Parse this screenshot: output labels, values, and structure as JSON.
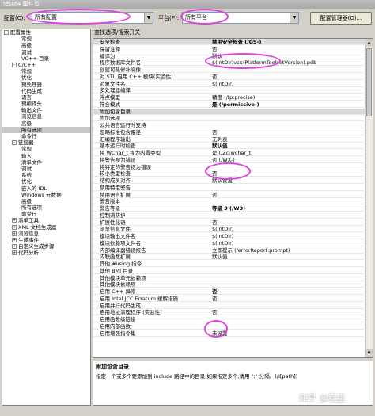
{
  "window": {
    "title": "test64 属性页"
  },
  "toolbar": {
    "config_label": "配置(C):",
    "config_value": "所有配置",
    "platform_label": "平台(P):",
    "platform_value": "所有平台",
    "config_manager_label": "配置管理器(O)..."
  },
  "panel_header": "查找选项/搜索开关",
  "tree": [
    {
      "label": "配置属性",
      "indent": 0,
      "exp": "-"
    },
    {
      "label": "常规",
      "indent": 2
    },
    {
      "label": "高级",
      "indent": 2
    },
    {
      "label": "调试",
      "indent": 2
    },
    {
      "label": "VC++ 目录",
      "indent": 2
    },
    {
      "label": "C/C++",
      "indent": 1,
      "exp": "-"
    },
    {
      "label": "常规",
      "indent": 2
    },
    {
      "label": "优化",
      "indent": 2
    },
    {
      "label": "预处理器",
      "indent": 2
    },
    {
      "label": "代码生成",
      "indent": 2
    },
    {
      "label": "语言",
      "indent": 2
    },
    {
      "label": "预编译头",
      "indent": 2
    },
    {
      "label": "输出文件",
      "indent": 2
    },
    {
      "label": "浏览信息",
      "indent": 2
    },
    {
      "label": "高级",
      "indent": 2
    },
    {
      "label": "所有选项",
      "indent": 2,
      "selected": true
    },
    {
      "label": "命令行",
      "indent": 2
    },
    {
      "label": "链接器",
      "indent": 1,
      "exp": "-"
    },
    {
      "label": "常规",
      "indent": 2
    },
    {
      "label": "输入",
      "indent": 2
    },
    {
      "label": "清单文件",
      "indent": 2
    },
    {
      "label": "调试",
      "indent": 2
    },
    {
      "label": "系统",
      "indent": 2
    },
    {
      "label": "优化",
      "indent": 2
    },
    {
      "label": "嵌入的 IDL",
      "indent": 2
    },
    {
      "label": "Windows 元数据",
      "indent": 2
    },
    {
      "label": "高级",
      "indent": 2
    },
    {
      "label": "所有选项",
      "indent": 2
    },
    {
      "label": "命令行",
      "indent": 2
    },
    {
      "label": "清单工具",
      "indent": 1,
      "exp": "+"
    },
    {
      "label": "XML 文档生成器",
      "indent": 1,
      "exp": "+"
    },
    {
      "label": "浏览信息",
      "indent": 1,
      "exp": "+"
    },
    {
      "label": "生成事件",
      "indent": 1,
      "exp": "+"
    },
    {
      "label": "自定义生成步骤",
      "indent": 1,
      "exp": "+"
    },
    {
      "label": "代码分析",
      "indent": 1,
      "exp": "+"
    }
  ],
  "properties": [
    {
      "name": "安全检查",
      "value": "禁用安全检查 (/GS-)",
      "bold": true,
      "section": true
    },
    {
      "name": "保留注释",
      "value": "否"
    },
    {
      "name": "编译为",
      "value": "默认"
    },
    {
      "name": "程序数据库文件名",
      "value": "$(IntDir)vc$(PlatformToolsetVersion).pdb"
    },
    {
      "name": "创建可热修补映像",
      "value": ""
    },
    {
      "name": "对 STL 启用 C++ 模块(实验性)",
      "value": "否"
    },
    {
      "name": "对象文件名",
      "value": "$(IntDir)"
    },
    {
      "name": "多处理器编译",
      "value": ""
    },
    {
      "name": "浮点模型",
      "value": "精度 (/fp:precise)"
    },
    {
      "name": "符合模式",
      "value": "是 (/permissive-)",
      "bold": true
    },
    {
      "name": "附加包含目录",
      "value": "",
      "section": true
    },
    {
      "name": "附加选项",
      "value": ""
    },
    {
      "name": "公共语言运行时支持",
      "value": ""
    },
    {
      "name": "忽略标准包含路径",
      "value": "否"
    },
    {
      "name": "汇编程序输出",
      "value": "无列表"
    },
    {
      "name": "基本运行时检查",
      "value": "默认值",
      "bold": true
    },
    {
      "name": "将 WChar_t 视为内置类型",
      "value": "是 (/Zc:wchar_t)"
    },
    {
      "name": "将警告视为错误",
      "value": "否 (/WX-)"
    },
    {
      "name": "将特定的警告视为错误",
      "value": ""
    },
    {
      "name": "较小类型检查",
      "value": "否"
    },
    {
      "name": "结构成员对齐",
      "value": "默认设置"
    },
    {
      "name": "禁用特定警告",
      "value": ""
    },
    {
      "name": "禁用语言扩展",
      "value": "否"
    },
    {
      "name": "警告版本",
      "value": ""
    },
    {
      "name": "警告等级",
      "value": "等级 3 (/W3)",
      "bold": true
    },
    {
      "name": "控制流防护",
      "value": ""
    },
    {
      "name": "扩展性化语",
      "value": "否"
    },
    {
      "name": "浏览信息文件",
      "value": "$(IntDir)"
    },
    {
      "name": "模块输出文件名",
      "value": "$(IntDir)"
    },
    {
      "name": "模块依赖项文件名",
      "value": "$(IntDir)"
    },
    {
      "name": "内部编译器错误报告",
      "value": "立即提示 (/errorReport:prompt)"
    },
    {
      "name": "内联函数扩展",
      "value": "默认值"
    },
    {
      "name": "其他 #using 指令",
      "value": ""
    },
    {
      "name": "其他 BMI 目录",
      "value": ""
    },
    {
      "name": "其他模块单元依赖项",
      "value": ""
    },
    {
      "name": "其他模块依赖项",
      "value": ""
    },
    {
      "name": "启用 C++ 异常",
      "value": "否",
      "bold": true
    },
    {
      "name": "启用 Intel JCC Erratum 缓解措施",
      "value": "否"
    },
    {
      "name": "启用并行代码生成",
      "value": ""
    },
    {
      "name": "启用地址清理程序 (实验性)",
      "value": "否"
    },
    {
      "name": "启用函数级链接",
      "value": ""
    },
    {
      "name": "启用内部函数",
      "value": ""
    },
    {
      "name": "启用增强指令集",
      "value": "未设置"
    }
  ],
  "description": {
    "title": "附加包含目录",
    "text": "指定一个或多个要添加到 include 路径中的目录;如果指定多个,请用 \";\" 分隔。(/I[path])"
  },
  "watermark": "知乎 @程星"
}
